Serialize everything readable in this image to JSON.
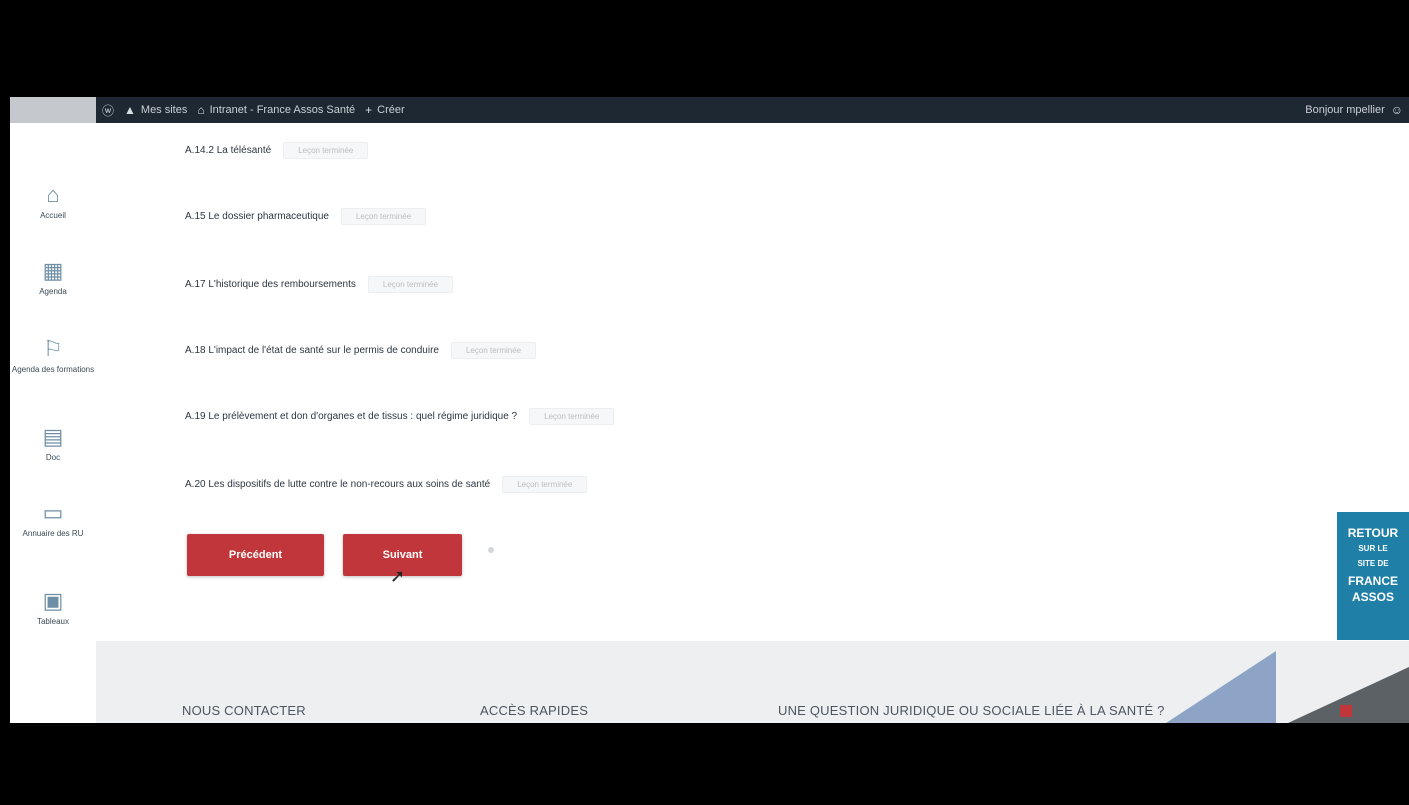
{
  "adminbar": {
    "items": [
      {
        "icon": "wordpress-icon",
        "label": "Mes sites"
      },
      {
        "icon": "home-icon",
        "label": "Intranet - France Assos Santé"
      },
      {
        "icon": "plus-icon",
        "label": "Créer"
      }
    ],
    "greeting": "Bonjour mpellier"
  },
  "sidebar": {
    "items": [
      {
        "icon": "home-icon",
        "label": "Accueil"
      },
      {
        "icon": "calendar-icon",
        "label": "Agenda"
      },
      {
        "icon": "flag-icon",
        "label": "Agenda des formations"
      },
      {
        "icon": "document-icon",
        "label": "Doc"
      },
      {
        "icon": "folder-icon",
        "label": "Annuaire des RU"
      },
      {
        "icon": "print-icon",
        "label": "Tableaux"
      }
    ]
  },
  "lessons": [
    {
      "title": "A.14.2 La télésanté",
      "status": "Leçon terminée"
    },
    {
      "title": "A.15 Le dossier pharmaceutique",
      "status": "Leçon terminée"
    },
    {
      "title": "A.17 L'historique des remboursements",
      "status": "Leçon terminée"
    },
    {
      "title": "A.18 L'impact de l'état de santé sur le permis de conduire",
      "status": "Leçon terminée"
    },
    {
      "title": "A.19 Le prélèvement et don d'organes et de tissus : quel régime juridique ?",
      "status": "Leçon terminée"
    },
    {
      "title": "A.20 Les dispositifs de lutte contre le non-recours aux soins de santé",
      "status": "Leçon terminée"
    }
  ],
  "nav": {
    "previous": "Précédent",
    "next": "Suivant"
  },
  "footer": {
    "contact": "NOUS CONTACTER",
    "quick": "ACCÈS RAPIDES",
    "question": "UNE QUESTION JURIDIQUE OU SOCIALE LIÉE À LA SANTÉ ?"
  },
  "promo": {
    "line1": "RETOUR",
    "line2": "SUR LE",
    "line3": "SITE DE",
    "line4": "FRANCE",
    "line5": "ASSOS"
  },
  "colors": {
    "adminbar": "#1e2833",
    "button": "#c0363a",
    "promo": "#1f7fa6"
  }
}
